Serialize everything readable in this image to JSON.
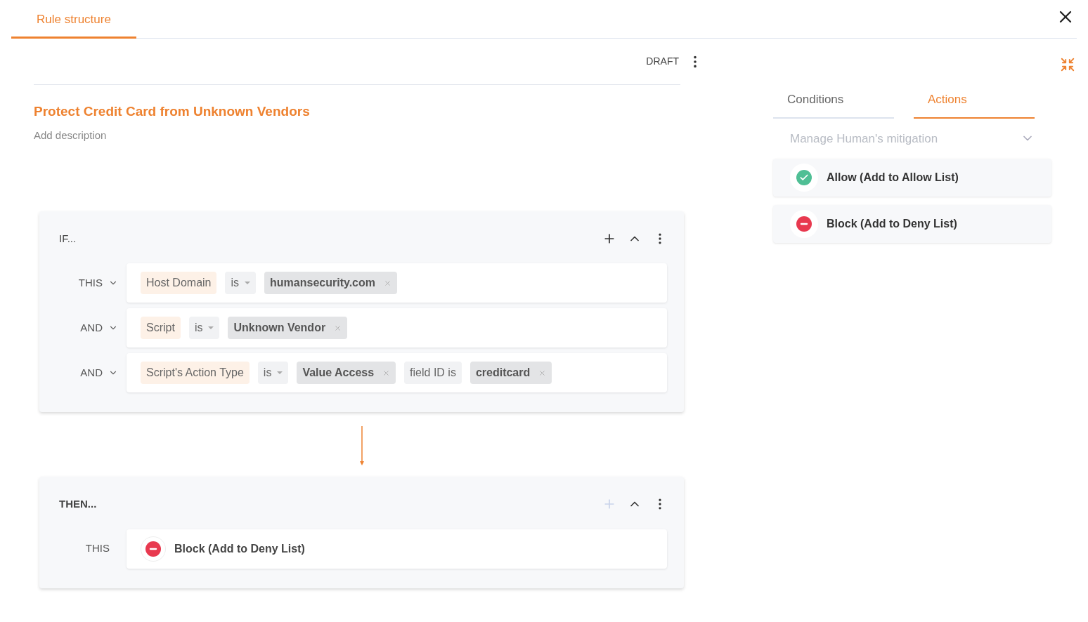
{
  "tabs": [
    {
      "label": "Rule structure",
      "selected": true
    }
  ],
  "status": "DRAFT",
  "rule": {
    "title": "Protect Credit Card from Unknown Vendors",
    "description_placeholder": "Add description"
  },
  "if_block": {
    "title": "IF...",
    "add_disabled": false,
    "rows": [
      {
        "connector": "THIS",
        "chips": [
          {
            "kind": "field",
            "text": "Host Domain"
          },
          {
            "kind": "operator",
            "text": "is"
          },
          {
            "kind": "value",
            "text": "humansecurity.com"
          }
        ]
      },
      {
        "connector": "AND",
        "chips": [
          {
            "kind": "field",
            "text": "Script"
          },
          {
            "kind": "operator",
            "text": "is"
          },
          {
            "kind": "value",
            "text": "Unknown Vendor"
          }
        ]
      },
      {
        "connector": "AND",
        "chips": [
          {
            "kind": "field",
            "text": "Script's Action Type"
          },
          {
            "kind": "operator",
            "text": "is"
          },
          {
            "kind": "value",
            "text": "Value Access"
          },
          {
            "kind": "text",
            "text": "field ID is"
          },
          {
            "kind": "value",
            "text": "creditcard"
          }
        ]
      }
    ]
  },
  "then_block": {
    "title": "THEN...",
    "add_disabled": true,
    "rows": [
      {
        "connector": "THIS",
        "action": {
          "kind": "block",
          "label": "Block (Add to Deny List)"
        }
      }
    ]
  },
  "panel": {
    "tabs": [
      {
        "label": "Conditions",
        "selected": false
      },
      {
        "label": "Actions",
        "selected": true
      }
    ],
    "dropdown": {
      "placeholder": "Manage Human's mitigation"
    },
    "actions": [
      {
        "kind": "allow",
        "label": "Allow (Add to Allow List)"
      },
      {
        "kind": "block",
        "label": "Block (Add to Deny List)"
      }
    ]
  }
}
